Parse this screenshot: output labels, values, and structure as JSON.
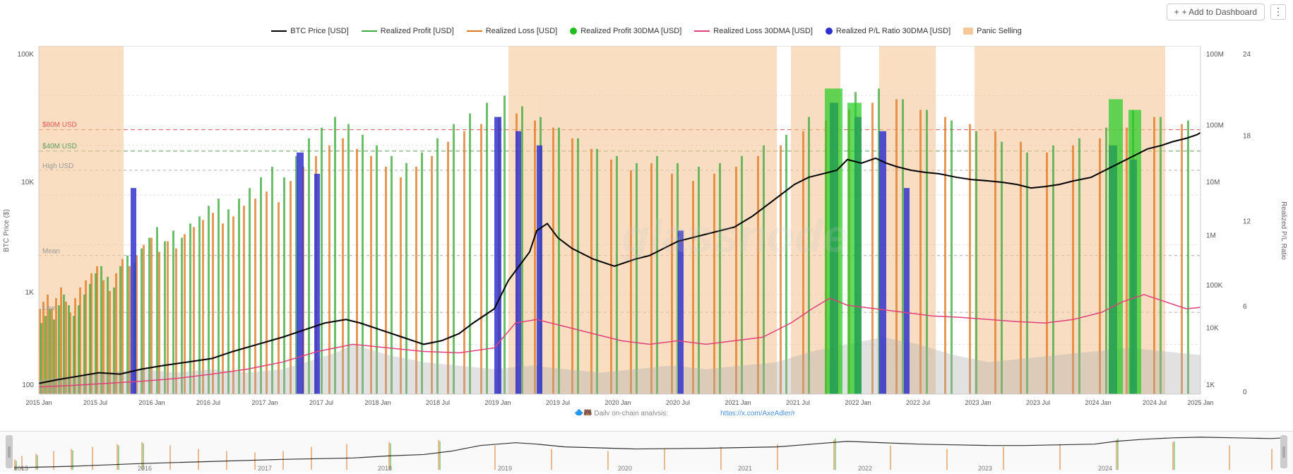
{
  "header": {
    "add_dashboard_label": "+ Add to Dashboard",
    "more_icon": "⋮"
  },
  "legend": {
    "items": [
      {
        "id": "btc-price",
        "label": "BTC Price [USD]",
        "type": "line",
        "color": "#000000"
      },
      {
        "id": "realized-profit",
        "label": "Realized Profit [USD]",
        "type": "line",
        "color": "#3daa3d"
      },
      {
        "id": "realized-loss",
        "label": "Realized Loss [USD]",
        "type": "line",
        "color": "#e07820"
      },
      {
        "id": "realized-profit-30dma",
        "label": "Realized Profit 30DMA [USD]",
        "type": "circle",
        "color": "#22bb22"
      },
      {
        "id": "realized-loss-30dma",
        "label": "Realized Loss 30DMA [USD]",
        "type": "line",
        "color": "#e0407a"
      },
      {
        "id": "realized-pl-ratio-30dma",
        "label": "Realized P/L Ratio 30DMA [USD]",
        "type": "circle",
        "color": "#3030cc"
      },
      {
        "id": "panic-selling",
        "label": "Panic Selling",
        "type": "rect",
        "color": "#f5c89a"
      }
    ]
  },
  "y_axis_left": {
    "label": "BTC Price ($)",
    "values": [
      "100K",
      "10K",
      "1K",
      "100"
    ]
  },
  "y_axis_right1": {
    "values": [
      "100M",
      "100M",
      "10M",
      "1M",
      "100K",
      "10K",
      "1K"
    ]
  },
  "y_axis_right2": {
    "values": [
      "24",
      "18",
      "12",
      "6",
      "0"
    ]
  },
  "x_axis": {
    "labels": [
      "2015 Jan",
      "2015 Jul",
      "2016 Jan",
      "2016 Jul",
      "2017 Jan",
      "2017 Jul",
      "2018 Jan",
      "2018 Jul",
      "2019 Jan",
      "2019 Jul",
      "2020 Jan",
      "2020 Jul",
      "2021 Jan",
      "2021 Jul",
      "2022 Jan",
      "2022 Jul",
      "2023 Jan",
      "2023 Jul",
      "2024 Jan",
      "2024 Jul",
      "2025 Jan"
    ]
  },
  "reference_lines": {
    "80m": {
      "label": "$80M USD",
      "color": "#e05555"
    },
    "40m": {
      "label": "$40M USD",
      "color": "#5c9e5c"
    },
    "high": {
      "label": "High USD",
      "color": "#aaaaaa"
    },
    "mean": {
      "label": "Mean",
      "color": "#aaaaaa"
    },
    "low": {
      "label": "Low",
      "color": "#aaaaaa"
    }
  },
  "attribution": {
    "icon": "🔷🐻",
    "text": "Daily on-chain analysis:",
    "link_text": "https://x.com/AxeAdler/r",
    "link_url": "https://x.com/AxeAdler/r"
  },
  "watermark": {
    "text": "glassnode"
  },
  "minimap": {
    "x_labels": [
      "2015",
      "2016",
      "2017",
      "2018",
      "2019",
      "2020",
      "2021",
      "2022",
      "2023",
      "2024"
    ]
  }
}
